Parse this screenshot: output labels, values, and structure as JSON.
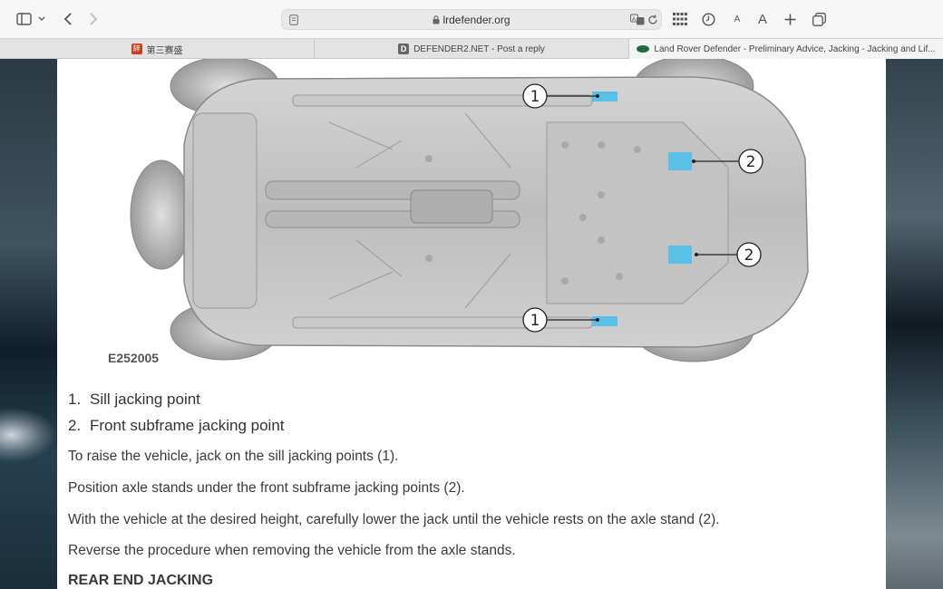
{
  "toolbar": {
    "url": "lrdefender.org",
    "font_small": "A",
    "font_large": "A"
  },
  "tabs": [
    {
      "label": "第三赛盛",
      "favicon_color": "#c8401c",
      "favicon_char": "辞"
    },
    {
      "label": "DEFENDER2.NET - Post a reply",
      "favicon_color": "#666666",
      "favicon_char": "D"
    },
    {
      "label": "Land Rover Defender - Preliminary Advice, Jacking - Jacking and Lif...",
      "favicon_color": "#1f6b3a",
      "favicon_char": ""
    }
  ],
  "figure": {
    "id": "E252005",
    "callout_1": "1",
    "callout_2": "2",
    "highlight_color": "#5bc0e8"
  },
  "legend": [
    {
      "num": "1.",
      "text": "Sill jacking point"
    },
    {
      "num": "2.",
      "text": "Front subframe jacking point"
    }
  ],
  "paragraphs": [
    "To raise the vehicle, jack on the sill jacking points (1).",
    "Position axle stands under the front subframe jacking points (2).",
    "With the vehicle at the desired height, carefully lower the jack until the vehicle rests on the axle stand (2).",
    "Reverse the procedure when removing the vehicle from the axle stands."
  ],
  "section_heading": "REAR END JACKING"
}
